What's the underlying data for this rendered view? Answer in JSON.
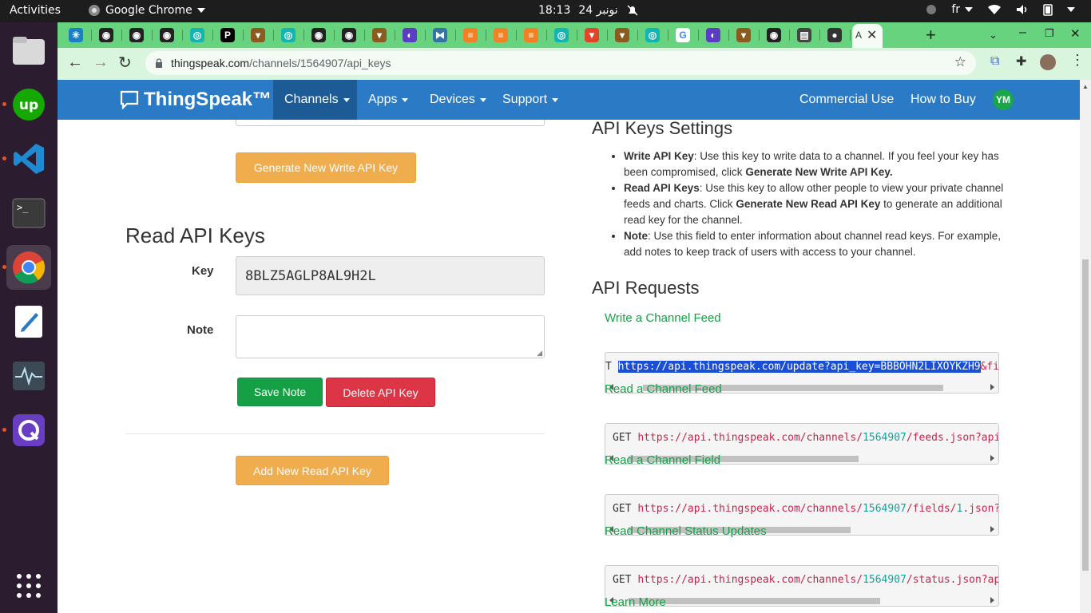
{
  "topbar": {
    "activities": "Activities",
    "app_name": "Google Chrome",
    "clock_time": "18:13",
    "clock_date": "24 نونبر",
    "language": "fr"
  },
  "browser": {
    "url_host": "thingspeak.com",
    "url_path": "/channels/1564907/api_keys",
    "active_tab_title": "A",
    "tab_favicons": [
      "nodejs-icon",
      "github-icon",
      "github-icon",
      "github-icon",
      "tealcircle-icon",
      "pycharm-icon",
      "hawk-icon",
      "tealcircle-icon",
      "github-icon",
      "github-icon",
      "hawk-icon",
      "purple-icon",
      "python-icon",
      "stackoverflow-icon",
      "stackoverflow-icon",
      "stackoverflow-icon",
      "tealcircle-icon",
      "gitlab-icon",
      "hawk-icon",
      "tealcircle-icon",
      "google-icon",
      "purple-icon",
      "hawk-icon",
      "github-icon",
      "reader-icon",
      "globe-icon"
    ]
  },
  "nav": {
    "brand": "ThingSpeak™",
    "items": [
      "Channels",
      "Apps",
      "Devices",
      "Support"
    ],
    "right_items": [
      "Commercial Use",
      "How to Buy"
    ],
    "avatar": "YM"
  },
  "left": {
    "generate_write_button": "Generate New Write API Key",
    "read_heading": "Read API Keys",
    "key_label": "Key",
    "key_value": "8BLZ5AGLP8AL9H2L",
    "note_label": "Note",
    "note_value": "",
    "save_note_button": "Save Note",
    "delete_key_button": "Delete API Key",
    "add_read_key_button": "Add New Read API Key"
  },
  "right": {
    "settings_heading": "API Keys Settings",
    "bullets": [
      {
        "term": "Write API Key",
        "text": ": Use this key to write data to a channel. If you feel your key has been compromised, click ",
        "bold_end": "Generate New Write API Key.",
        "tail": ""
      },
      {
        "term": "Read API Keys",
        "text": ": Use this key to allow other people to view your private channel feeds and charts. Click ",
        "bold_end": "Generate New Read API Key",
        "tail": " to generate an additional read key for the channel."
      },
      {
        "term": "Note",
        "text": ": Use this field to enter information about channel read keys. For example, add notes to keep track of users with access to your channel.",
        "bold_end": "",
        "tail": ""
      }
    ],
    "requests_heading": "API Requests",
    "requests": [
      {
        "title": "Write a Channel Feed",
        "prefix": "T ",
        "url": "https://api.thingspeak.com/update?api_key=BBBOHN2LIXOYKZH9",
        "suffix": "&fie",
        "scroll": [
          0.07,
          0.88
        ]
      },
      {
        "title": "Read a Channel Feed",
        "prefix": "GET ",
        "url_a": "https://api.thingspeak.com/channels/",
        "channel": "1564907",
        "url_b": "/feeds.json?api",
        "scroll": [
          0.03,
          0.65
        ]
      },
      {
        "title": "Read a Channel Field",
        "prefix": "GET ",
        "url_a": "https://api.thingspeak.com/channels/",
        "channel": "1564907",
        "url_b": "/fields/",
        "field": "1",
        "url_c": ".json?",
        "scroll": [
          0.03,
          0.63
        ]
      },
      {
        "title": "Read Channel Status Updates",
        "prefix": "GET ",
        "url_a": "https://api.thingspeak.com/channels/",
        "channel": "1564907",
        "url_b": "/status.json?ap",
        "scroll": [
          0.03,
          0.71
        ]
      }
    ],
    "learn_more": "Learn More"
  },
  "colors": {
    "tab_strip": "#67d37f",
    "nav_blue": "#2a7ac5",
    "link_green": "#16a046",
    "warning": "#f0ad4e",
    "danger": "#dc3545"
  }
}
